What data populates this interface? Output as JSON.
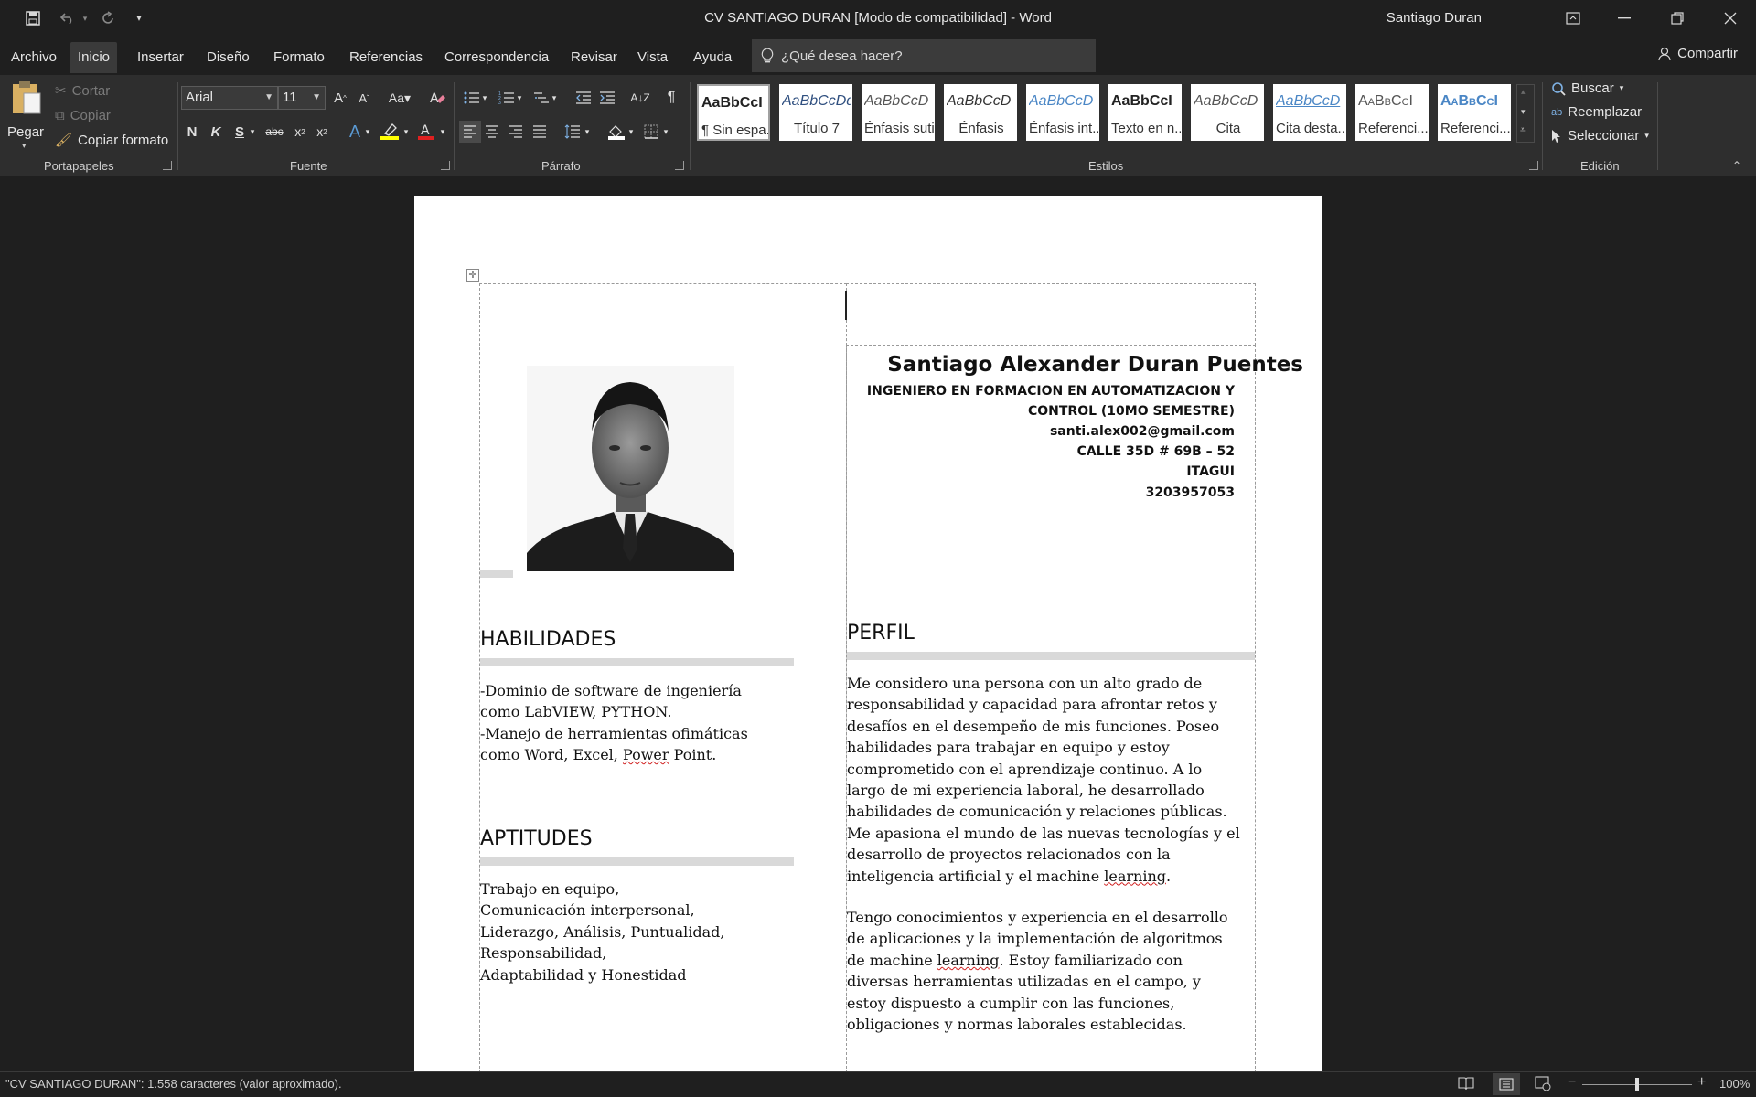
{
  "window": {
    "title": "CV SANTIAGO DURAN [Modo de compatibilidad]  -  Word",
    "user": "Santiago Duran",
    "icons": [
      "save-icon",
      "undo-icon",
      "redo-icon",
      "customize-icon",
      "ribbon-display-icon",
      "minimize-icon",
      "restore-icon",
      "close-icon"
    ]
  },
  "menu": {
    "tabs": [
      "Archivo",
      "Inicio",
      "Insertar",
      "Diseño",
      "Formato",
      "Referencias",
      "Correspondencia",
      "Revisar",
      "Vista",
      "Ayuda"
    ],
    "active_tab": "Inicio",
    "tell_me": "¿Qué desea hacer?",
    "share": "Compartir"
  },
  "ribbon": {
    "clipboard": {
      "paste": "Pegar",
      "cut": "Cortar",
      "copy": "Copiar",
      "format_painter": "Copiar formato",
      "label": "Portapapeles"
    },
    "font": {
      "family": "Arial",
      "size": "11",
      "bold": "N",
      "italic": "K",
      "underline": "S",
      "label": "Fuente"
    },
    "paragraph": {
      "label": "Párrafo"
    },
    "styles": {
      "label": "Estilos",
      "items": [
        {
          "sample": "AaBbCcI",
          "name": "¶ Sin espa...",
          "color": "#111111"
        },
        {
          "sample": "AaBbCcDd",
          "name": "Título 7",
          "color": "#2f4f7f"
        },
        {
          "sample": "AaBbCcD",
          "name": "Énfasis sutil",
          "color": "#555555"
        },
        {
          "sample": "AaBbCcD",
          "name": "Énfasis",
          "color": "#333333"
        },
        {
          "sample": "AaBbCcD",
          "name": "Énfasis int...",
          "color": "#4a86c5"
        },
        {
          "sample": "AaBbCcI",
          "name": "Texto en n...",
          "color": "#111111"
        },
        {
          "sample": "AaBbCcD",
          "name": "Cita",
          "color": "#555555"
        },
        {
          "sample": "AaBbCcD",
          "name": "Cita desta...",
          "color": "#4a86c5"
        },
        {
          "sample": "AaBbCcI",
          "name": "Referenci...",
          "color": "#555555"
        },
        {
          "sample": "AaBbCcI",
          "name": "Referenci...",
          "color": "#4a86c5"
        }
      ]
    },
    "editing": {
      "find": "Buscar",
      "replace": "Reemplazar",
      "select": "Seleccionar",
      "label": "Edición"
    }
  },
  "document": {
    "name": "Santiago Alexander Duran Puentes",
    "title_line1": "INGENIERO EN FORMACION EN AUTOMATIZACION Y",
    "title_line2": "CONTROL (10MO SEMESTRE)",
    "email": "santi.alex002@gmail.com",
    "address": "CALLE 35D # 69B – 52",
    "city": "ITAGUI",
    "phone": "3203957053",
    "skills_heading": "HABILIDADES",
    "skills": [
      "-Dominio de software de ingeniería",
      "como LabVIEW, PYTHON.",
      "-Manejo de herramientas ofimáticas",
      "como Word, Excel, Power Point."
    ],
    "aptitudes_heading": "APTITUDES",
    "aptitudes": [
      "Trabajo en equipo,",
      "Comunicación interpersonal,",
      "Liderazgo, Análisis, Puntualidad,",
      "Responsabilidad,",
      "Adaptabilidad y Honestidad"
    ],
    "profile_heading": "PERFIL",
    "profile_p1": [
      "Me considero una persona con un alto grado de",
      "responsabilidad y capacidad para afrontar retos y",
      "desafíos en el desempeño de mis funciones. Poseo",
      "habilidades para trabajar en equipo y estoy",
      "comprometido con el aprendizaje continuo. A lo",
      "largo de mi experiencia laboral, he desarrollado",
      "habilidades de comunicación y relaciones públicas.",
      "Me apasiona el mundo de las nuevas tecnologías y el",
      "desarrollo de proyectos relacionados con la",
      "inteligencia artificial y el machine learning."
    ],
    "profile_p2": [
      "Tengo conocimientos y experiencia en el desarrollo",
      "de aplicaciones y la implementación de algoritmos",
      "de machine learning. Estoy familiarizado con",
      "diversas herramientas utilizadas en el campo, y",
      "estoy dispuesto a cumplir con las funciones,",
      "obligaciones y normas laborales establecidas."
    ]
  },
  "status": {
    "text": "\"CV SANTIAGO DURAN\": 1.558 caracteres (valor aproximado).",
    "zoom": "100%",
    "zoom_level": 1.0
  }
}
